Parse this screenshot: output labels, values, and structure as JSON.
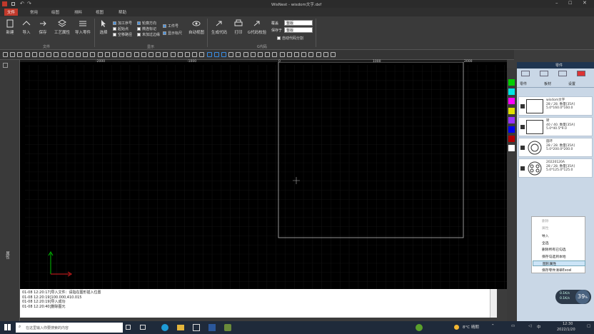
{
  "window": {
    "title": "WisNest - wisdom文字.dxf"
  },
  "menu": [
    {
      "label": "文件",
      "active": true
    },
    {
      "label": "常用",
      "active": false
    },
    {
      "label": "绘图",
      "active": false
    },
    {
      "label": "排料",
      "active": false
    },
    {
      "label": "视图",
      "active": false
    },
    {
      "label": "帮助",
      "active": false
    }
  ],
  "ribbon": {
    "file_group": [
      "新建",
      "导入",
      "保存",
      "工艺属性",
      "导入零件"
    ],
    "file_group_label": "文件",
    "select_label": "选择",
    "checks_col1": [
      "加工序号",
      "起始点",
      "空移路径"
    ],
    "checks_col2": [
      "轮廓方向",
      "微连标记",
      "未加过边缘"
    ],
    "checks_col3": [
      "工件号",
      "显示标尺"
    ],
    "display_group_label": "显示",
    "auto_view": "自动视图",
    "gen_code": "生成代码",
    "print": "打印",
    "code_check": "G代码校验",
    "output_label": "G代码",
    "field1_label": "覆盖",
    "field1_value": "整版",
    "field2_label": "保存于",
    "field2_value": "整版",
    "auto_gen": "自动代码分割"
  },
  "rulers": {
    "top_ticks": [
      "-2000",
      "-1000",
      "0",
      "1000",
      "2000"
    ],
    "left_tick": "1000"
  },
  "left_sidebar_label": "属性",
  "log_lines": [
    "01-08 12:20:17]导入文件：请指在图形插入位置",
    "01-08 12:20:19]100.000,410.015",
    "01-08 12:20:19]导入成功",
    "01-08 12:20:40]删除图元"
  ],
  "colors": [
    "#00d000",
    "#00e5e5",
    "#ff00ff",
    "#e0e000",
    "#9933ff",
    "#0000ee",
    "#b00000",
    "#ffffff"
  ],
  "right_panel": {
    "title": "零件",
    "tabs": [
      "零件",
      "板材",
      "设置"
    ],
    "parts": [
      {
        "name": "wisdom文字",
        "count": "28 / 28. 数量[35A]",
        "size": "5.0*160.0*160.0"
      },
      {
        "name": "转",
        "count": "40 / 40. 数量[35A]",
        "size": "5.0*40.5*9.0"
      },
      {
        "name": "圆环",
        "count": "28 / 28. 数量[35A]",
        "size": "5.0*200.0*200.0"
      },
      {
        "name": "20220120A",
        "count": "28 / 28. 数量[35A]",
        "size": "5.0*125.0*125.0"
      }
    ]
  },
  "context_menu": [
    {
      "label": "删除",
      "disabled": true,
      "highlight": false
    },
    {
      "label": "属性",
      "disabled": true,
      "highlight": false
    },
    {
      "label": "导入",
      "disabled": false,
      "highlight": false
    },
    {
      "label": "全选",
      "disabled": false,
      "highlight": false
    },
    {
      "label": "删除所有已勾选",
      "disabled": false,
      "highlight": false
    },
    {
      "label": "保存勾选到本地",
      "disabled": false,
      "highlight": false
    },
    {
      "label": "图形属性",
      "disabled": false,
      "highlight": true
    },
    {
      "label": "保存零件清单Excel",
      "disabled": false,
      "highlight": false
    }
  ],
  "speed_widget": {
    "value": "39",
    "unit": "%",
    "up": "0.1K/s",
    "down": "0.1K/s"
  },
  "taskbar": {
    "search_placeholder": "在这里输入你要搜索的内容",
    "weather": "8°C 晴朗",
    "time": "12:30",
    "date": "2022/1/20"
  }
}
